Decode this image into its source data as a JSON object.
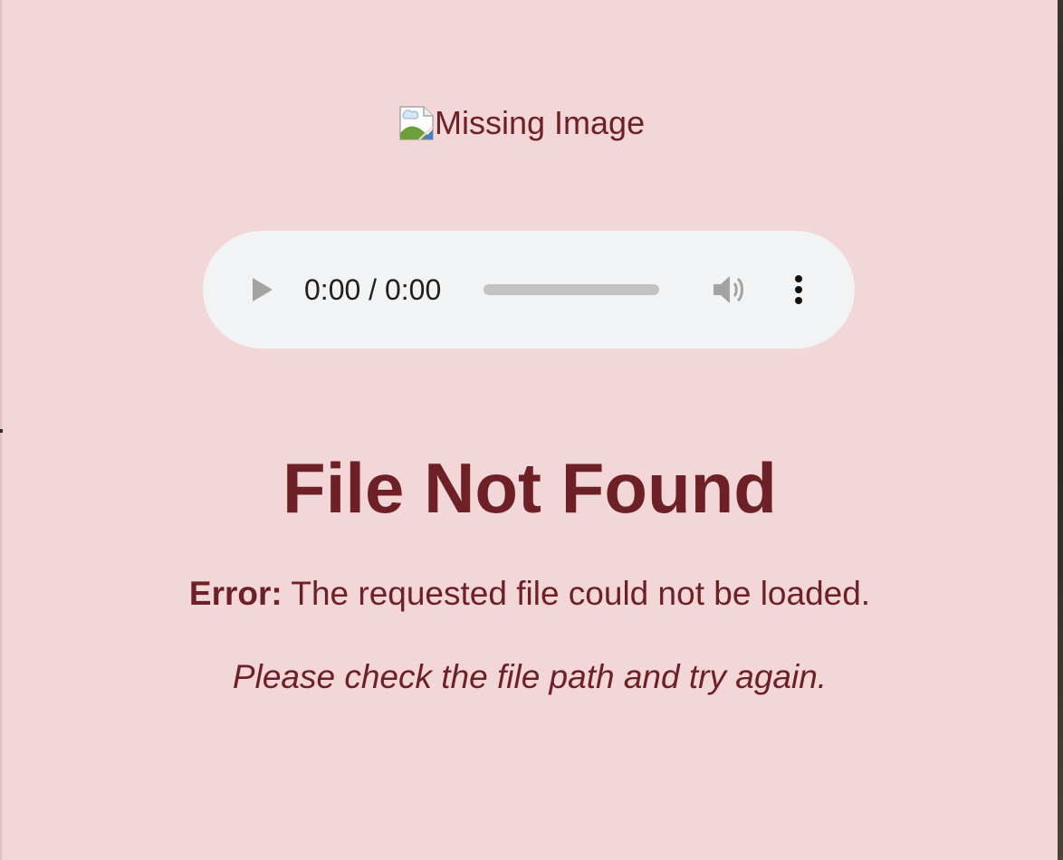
{
  "image": {
    "alt_text": "Missing Image",
    "icon": "broken-image-icon"
  },
  "audio_player": {
    "time_display": "0:00 / 0:00",
    "progress": 0,
    "play_icon": "play-icon",
    "volume_icon": "volume-icon",
    "menu_icon": "more-vertical-icon"
  },
  "message": {
    "title": "File Not Found",
    "error_label": "Error:",
    "error_text": " The requested file could not be loaded.",
    "hint": "Please check the file path and try again."
  },
  "colors": {
    "background": "#f3d7d8",
    "text": "#6d2126",
    "player_background": "#f1f3f4"
  }
}
